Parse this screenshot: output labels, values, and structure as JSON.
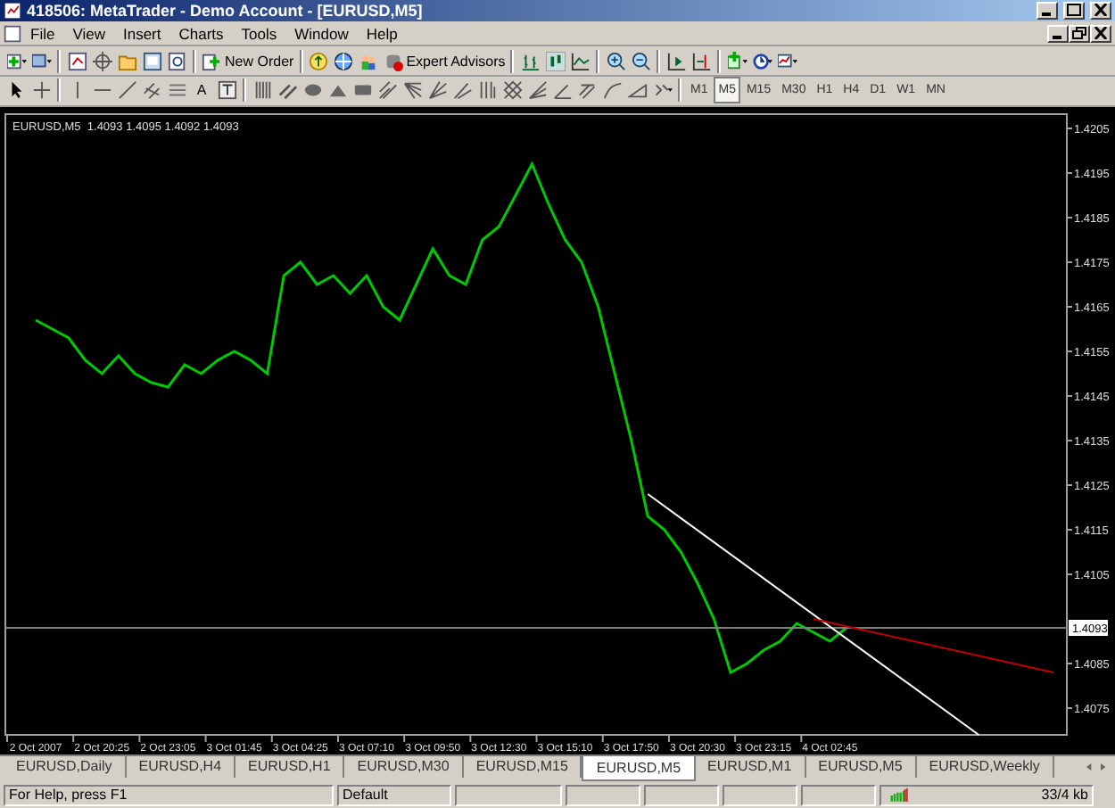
{
  "window": {
    "title": "418506: MetaTrader - Demo Account - [EURUSD,M5]"
  },
  "menu": [
    "File",
    "View",
    "Insert",
    "Charts",
    "Tools",
    "Window",
    "Help"
  ],
  "toolbar": {
    "new_order": "New Order",
    "expert_advisors": "Expert Advisors",
    "text_tool": "A"
  },
  "timeframes": [
    {
      "label": "M1",
      "selected": false
    },
    {
      "label": "M5",
      "selected": true
    },
    {
      "label": "M15",
      "selected": false
    },
    {
      "label": "M30",
      "selected": false
    },
    {
      "label": "H1",
      "selected": false
    },
    {
      "label": "H4",
      "selected": false
    },
    {
      "label": "D1",
      "selected": false
    },
    {
      "label": "W1",
      "selected": false
    },
    {
      "label": "MN",
      "selected": false
    }
  ],
  "chart": {
    "quote": "1.4093 1.4095 1.4092 1.4093",
    "price_label": "1.4093",
    "objects": [
      {
        "kind": "hline",
        "color": "#808080"
      },
      {
        "kind": "trendline",
        "color": "#ffffff"
      },
      {
        "kind": "trendline",
        "color": "#c00000"
      }
    ],
    "chart_data": {
      "type": "line",
      "categories": [
        "2 Oct 2007",
        null,
        null,
        null,
        "2 Oct 20:25",
        null,
        null,
        null,
        "2 Oct 23:05",
        null,
        null,
        null,
        "3 Oct 01:45",
        null,
        null,
        null,
        "3 Oct 04:25",
        null,
        null,
        null,
        "3 Oct 07:10",
        null,
        null,
        null,
        "3 Oct 09:50",
        null,
        null,
        null,
        "3 Oct 12:30",
        null,
        null,
        null,
        "3 Oct 15:10",
        null,
        null,
        null,
        "3 Oct 17:50",
        null,
        null,
        null,
        "3 Oct 20:30",
        null,
        null,
        null,
        "3 Oct 23:15",
        null,
        null,
        null,
        "4 Oct 02:45",
        null,
        null,
        null,
        null,
        null,
        null,
        null,
        null,
        null,
        null,
        null,
        null,
        null
      ],
      "ylim": [
        1.4069,
        1.42082
      ],
      "yticks": [
        1.4205,
        1.4195,
        1.4185,
        1.4175,
        1.4165,
        1.4155,
        1.4145,
        1.4135,
        1.4125,
        1.4115,
        1.4105,
        1.4085,
        1.4075
      ],
      "series": [
        {
          "name": "EURUSD,M5",
          "color": "#00c800",
          "values": [
            1.4162,
            1.416,
            1.4158,
            1.4153,
            1.415,
            1.4154,
            1.415,
            1.4148,
            1.4147,
            1.4152,
            1.415,
            1.4153,
            1.4155,
            1.4153,
            1.415,
            1.4172,
            1.4175,
            1.417,
            1.4172,
            1.4168,
            1.4172,
            1.4165,
            1.4162,
            1.417,
            1.4178,
            1.4172,
            1.417,
            1.418,
            1.4183,
            1.419,
            1.4197,
            1.4188,
            1.418,
            1.4175,
            1.4165,
            1.415,
            1.4135,
            1.4118,
            1.4115,
            1.411,
            1.4103,
            1.4095,
            1.4083,
            1.4085,
            1.4088,
            1.409,
            1.4094,
            1.4092,
            1.409,
            1.4093,
            null,
            null,
            null,
            null,
            null,
            null,
            null,
            null,
            null,
            null,
            null,
            null
          ]
        }
      ]
    }
  },
  "chart_tabs": [
    {
      "label": "EURUSD,Daily",
      "selected": false
    },
    {
      "label": "EURUSD,H4",
      "selected": false
    },
    {
      "label": "EURUSD,H1",
      "selected": false
    },
    {
      "label": "EURUSD,M30",
      "selected": false
    },
    {
      "label": "EURUSD,M15",
      "selected": false
    },
    {
      "label": "EURUSD,M5",
      "selected": true
    },
    {
      "label": "EURUSD,M1",
      "selected": false
    },
    {
      "label": "EURUSD,M5",
      "selected": false
    },
    {
      "label": "EURUSD,Weekly",
      "selected": false
    }
  ],
  "status_bar": {
    "help": "For Help, press F1",
    "profile": "Default",
    "traffic": "33/4 kb"
  }
}
